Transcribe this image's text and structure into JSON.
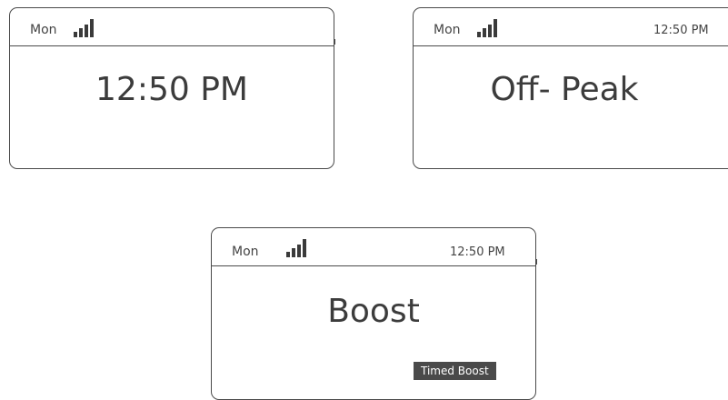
{
  "screens": [
    {
      "day": "Mon",
      "time": "",
      "main": "12:50 PM",
      "badge": ""
    },
    {
      "day": "Mon",
      "time": "12:50 PM",
      "main": "Off- Peak",
      "badge": ""
    },
    {
      "day": "Mon",
      "time": "12:50 PM",
      "main": "Boost",
      "badge": "Timed Boost"
    }
  ],
  "icons": {
    "signal": "signal-strength-icon"
  }
}
